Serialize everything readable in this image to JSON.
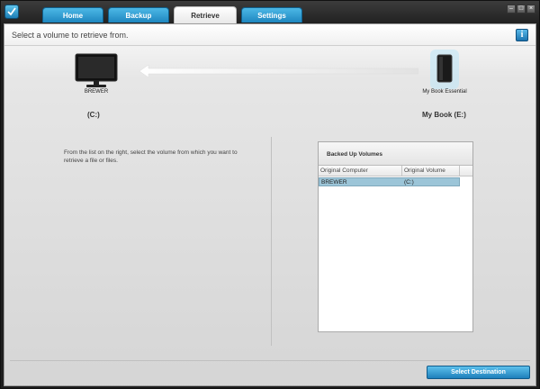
{
  "tabs": [
    {
      "label": "Home",
      "active": false
    },
    {
      "label": "Backup",
      "active": false
    },
    {
      "label": "Retrieve",
      "active": true
    },
    {
      "label": "Settings",
      "active": false
    }
  ],
  "window_controls": {
    "minimize": "–",
    "maximize": "□",
    "close": "×"
  },
  "header": {
    "text": "Select a volume to retrieve from.",
    "info_icon": "i"
  },
  "source": {
    "name": "BREWER",
    "drive": "(C:)"
  },
  "destination": {
    "name": "My Book Essential",
    "drive": "My Book (E:)"
  },
  "instructions": "From the list on the right, select the volume from which you want to retrieve a file or files.",
  "volumes": {
    "title": "Backed Up Volumes",
    "columns": [
      "Original Computer",
      "Original Volume"
    ],
    "rows": [
      {
        "computer": "BREWER",
        "volume": "(C:)",
        "selected": true
      }
    ]
  },
  "footer": {
    "select_button": "Select Destination"
  },
  "colors": {
    "accent": "#1e86bf",
    "selection": "#9cc5d8",
    "background": "#d4d4d4"
  }
}
